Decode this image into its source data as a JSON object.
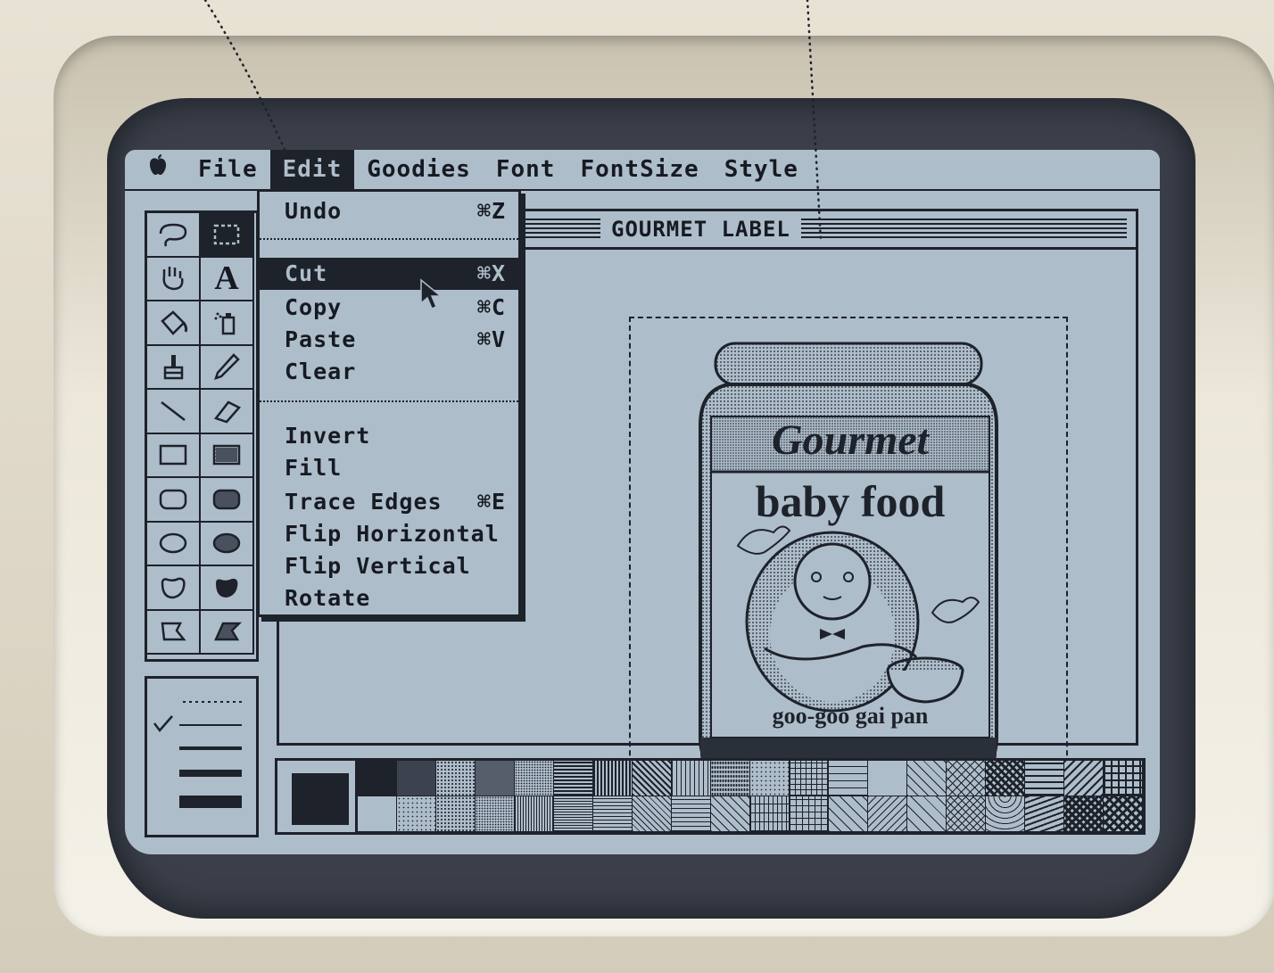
{
  "menubar": {
    "apple_glyph": "",
    "items": [
      "File",
      "Edit",
      "Goodies",
      "Font",
      "FontSize",
      "Style"
    ],
    "active": "Edit"
  },
  "window": {
    "title": "GOURMET LABEL"
  },
  "edit_menu": {
    "items": [
      {
        "label": "Undo",
        "shortcut": "⌘Z"
      },
      {
        "label": "Cut",
        "shortcut": "⌘X",
        "highlighted": true
      },
      {
        "label": "Copy",
        "shortcut": "⌘C"
      },
      {
        "label": "Paste",
        "shortcut": "⌘V"
      },
      {
        "label": "Clear",
        "shortcut": ""
      },
      {
        "label": "Invert",
        "shortcut": ""
      },
      {
        "label": "Fill",
        "shortcut": ""
      },
      {
        "label": "Trace Edges",
        "shortcut": "⌘E"
      },
      {
        "label": "Flip Horizontal",
        "shortcut": ""
      },
      {
        "label": "Flip Vertical",
        "shortcut": ""
      },
      {
        "label": "Rotate",
        "shortcut": ""
      }
    ]
  },
  "canvas_art": {
    "brand": "Gourmet",
    "product": "baby food",
    "flavor": "goo-goo gai pan"
  },
  "tools": [
    "lasso",
    "selection-rect",
    "grabber",
    "text",
    "paint-bucket",
    "spray-can",
    "brush",
    "pencil",
    "line",
    "eraser",
    "rectangle",
    "filled-rectangle",
    "rounded-rectangle",
    "filled-rounded-rectangle",
    "oval",
    "filled-oval",
    "freeform",
    "filled-freeform",
    "polygon",
    "filled-polygon"
  ],
  "colors": {
    "screen": "#aebdca",
    "ink": "#1d222b"
  }
}
